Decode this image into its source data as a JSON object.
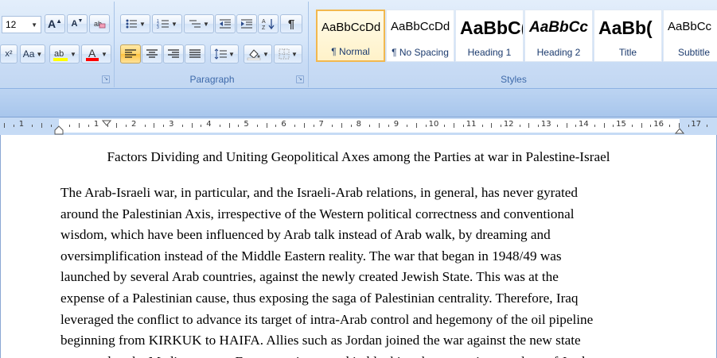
{
  "font_group": {
    "font_size": "12",
    "grow_font_label": "A",
    "shrink_font_label": "A",
    "change_case_label": "Aa",
    "superscript_label": "x²"
  },
  "paragraph_group": {
    "label": "Paragraph"
  },
  "styles_group": {
    "label": "Styles",
    "tiles": [
      {
        "sample": "AaBbCcDd",
        "name": "¶ Normal",
        "selected": true
      },
      {
        "sample": "AaBbCcDd",
        "name": "¶ No Spacing",
        "selected": false
      },
      {
        "sample": "AaBbC(",
        "name": "Heading 1",
        "selected": false
      },
      {
        "sample": "AaBbCc",
        "name": "Heading 2",
        "selected": false
      },
      {
        "sample": "AaBb(",
        "name": "Title",
        "selected": false
      },
      {
        "sample": "AaBbCc",
        "name": "Subtitle",
        "selected": false
      }
    ]
  },
  "ruler": {
    "numbers": [
      "1",
      "1",
      "2",
      "3",
      "4",
      "5",
      "6",
      "7",
      "8",
      "9",
      "10",
      "11",
      "12",
      "13",
      "14",
      "15",
      "16",
      "17"
    ]
  },
  "document": {
    "title": "Factors Dividing and Uniting Geopolitical Axes among the Parties at war in Palestine-Israel",
    "lines": [
      "The Arab-Israeli war, in particular, and the Israeli-Arab relations, in general, has never gyrated",
      "around the Palestinian Axis, irrespective of the Western political correctness and conventional",
      "wisdom, which have been influenced by Arab talk instead of Arab walk, by dreaming and",
      "oversimplification instead of the Middle Eastern reality. The war that began in 1948/49 was",
      "launched by several Arab countries, against the newly created Jewish State. This was at the",
      "expense of a Palestinian cause, thus exposing the saga of Palestinian centrality. Therefore, Iraq",
      "leveraged the conflict to advance its target of intra-Arab control and hegemony of the oil pipeline",
      "beginning from KIRKUK  to HAIFA.  Allies such as Jordan joined the war against the new state",
      "to extend to the Mediterranean. Egypt was interested in blocking the expansionary plans of Jordan"
    ]
  },
  "colors": {
    "highlight": "#ffff00",
    "font_color": "#ff0000",
    "selected_style_border": "#f2b84f"
  }
}
